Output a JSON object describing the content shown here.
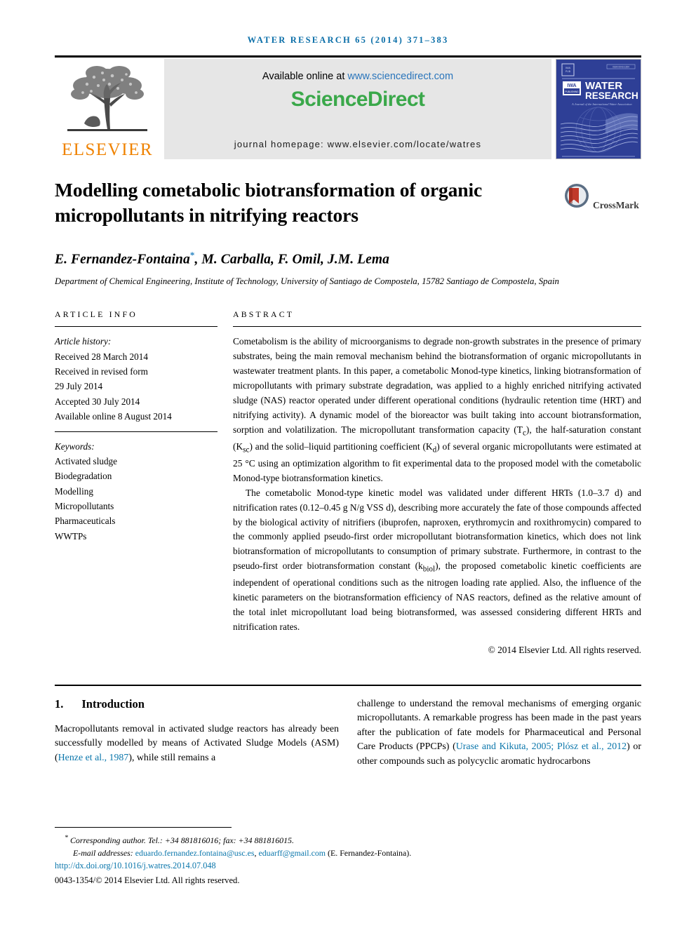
{
  "running_head": "water research 65 (2014) 371–383",
  "masthead": {
    "publisher_name": "ELSEVIER",
    "available_prefix": "Available online at ",
    "available_url": "www.sciencedirect.com",
    "sciencedirect_logo": "ScienceDirect",
    "journal_homepage": "journal homepage: www.elsevier.com/locate/watres",
    "cover": {
      "journal_line1": "WATER",
      "journal_line2": "RESEARCH",
      "association": "IWA",
      "tagline": "A Journal of the International Water Association",
      "issn_box": "ISSN 0043-1354"
    }
  },
  "article": {
    "title": "Modelling cometabolic biotransformation of organic micropollutants in nitrifying reactors",
    "crossmark_label": "CrossMark",
    "authors": "E. Fernandez-Fontaina",
    "corresponding_marker": "*",
    "authors_rest": ", M. Carballa, F. Omil, J.M. Lema",
    "affiliation": "Department of Chemical Engineering, Institute of Technology, University of Santiago de Compostela, 15782 Santiago de Compostela, Spain"
  },
  "article_info": {
    "heading": "article info",
    "history_label": "Article history:",
    "history": [
      "Received 28 March 2014",
      "Received in revised form",
      "29 July 2014",
      "Accepted 30 July 2014",
      "Available online 8 August 2014"
    ],
    "keywords_label": "Keywords:",
    "keywords": [
      "Activated sludge",
      "Biodegradation",
      "Modelling",
      "Micropollutants",
      "Pharmaceuticals",
      "WWTPs"
    ]
  },
  "abstract": {
    "heading": "abstract",
    "paragraph_1_a": "Cometabolism is the ability of microorganisms to degrade non-growth substrates in the presence of primary substrates, being the main removal mechanism behind the biotransformation of organic micropollutants in wastewater treatment plants. In this paper, a cometabolic Monod-type kinetics, linking biotransformation of micropollutants with primary substrate degradation, was applied to a highly enriched nitrifying activated sludge (NAS) reactor operated under different operational conditions (hydraulic retention time (HRT) and nitrifying activity). A dynamic model of the bioreactor was built taking into account biotransformation, sorption and volatilization. The micropollutant transformation capacity (T",
    "sub_tc": "c",
    "paragraph_1_b": "), the half-saturation constant (K",
    "sub_ksc": "sc",
    "paragraph_1_c": ") and the solid–liquid partitioning coefficient (K",
    "sub_kd": "d",
    "paragraph_1_d": ") of several organic micropollutants were estimated at 25 °C using an optimization algorithm to fit experimental data to the proposed model with the cometabolic Monod-type biotransformation kinetics.",
    "paragraph_2_a": "The cometabolic Monod-type kinetic model was validated under different HRTs (1.0–3.7 d) and nitrification rates (0.12–0.45 g N/g VSS d), describing more accurately the fate of those compounds affected by the biological activity of nitrifiers (ibuprofen, naproxen, erythromycin and roxithromycin) compared to the commonly applied pseudo-first order micropollutant biotransformation kinetics, which does not link biotransformation of micropollutants to consumption of primary substrate. Furthermore, in contrast to the pseudo-first order biotransformation constant (k",
    "sub_kbiol": "biol",
    "paragraph_2_b": "), the proposed cometabolic kinetic coefficients are independent of operational conditions such as the nitrogen loading rate applied. Also, the influence of the kinetic parameters on the biotransformation efficiency of NAS reactors, defined as the relative amount of the total inlet micropollutant load being biotransformed, was assessed considering different HRTs and nitrification rates.",
    "copyright": "© 2014 Elsevier Ltd. All rights reserved."
  },
  "introduction": {
    "number": "1.",
    "title": "Introduction",
    "left_a": "Macropollutants removal in activated sludge reactors has already been successfully modelled by means of Activated Sludge Models (ASM) (",
    "left_cite_1": "Henze et al., 1987",
    "left_b": "), while still remains a",
    "right_a": "challenge to understand the removal mechanisms of emerging organic micropollutants. A remarkable progress has been made in the past years after the publication of fate models for Pharmaceutical and Personal Care Products (PPCPs) (",
    "right_cite_1": "Urase and Kikuta, 2005; Plósz et al., 2012",
    "right_b": ") or other compounds such as polycyclic aromatic hydrocarbons"
  },
  "footer": {
    "corresponding_marker": "*",
    "corresponding": "Corresponding author. Tel.: +34 881816016; fax: +34 881816015.",
    "email_label": "E-mail addresses:",
    "email_1": "eduardo.fernandez.fontaina@usc.es",
    "email_sep": ", ",
    "email_2": "eduarff@gmail.com",
    "email_owner": " (E. Fernandez-Fontaina).",
    "doi": "http://dx.doi.org/10.1016/j.watres.2014.07.048",
    "issn": "0043-1354/© 2014 Elsevier Ltd. All rights reserved."
  },
  "colors": {
    "journal_blue": "#0a6ea8",
    "link_blue": "#0a76ab",
    "sciencedirect_green": "#3aa84a",
    "elsevier_orange": "#ef8200",
    "cover_blue": "#2e3f96"
  }
}
